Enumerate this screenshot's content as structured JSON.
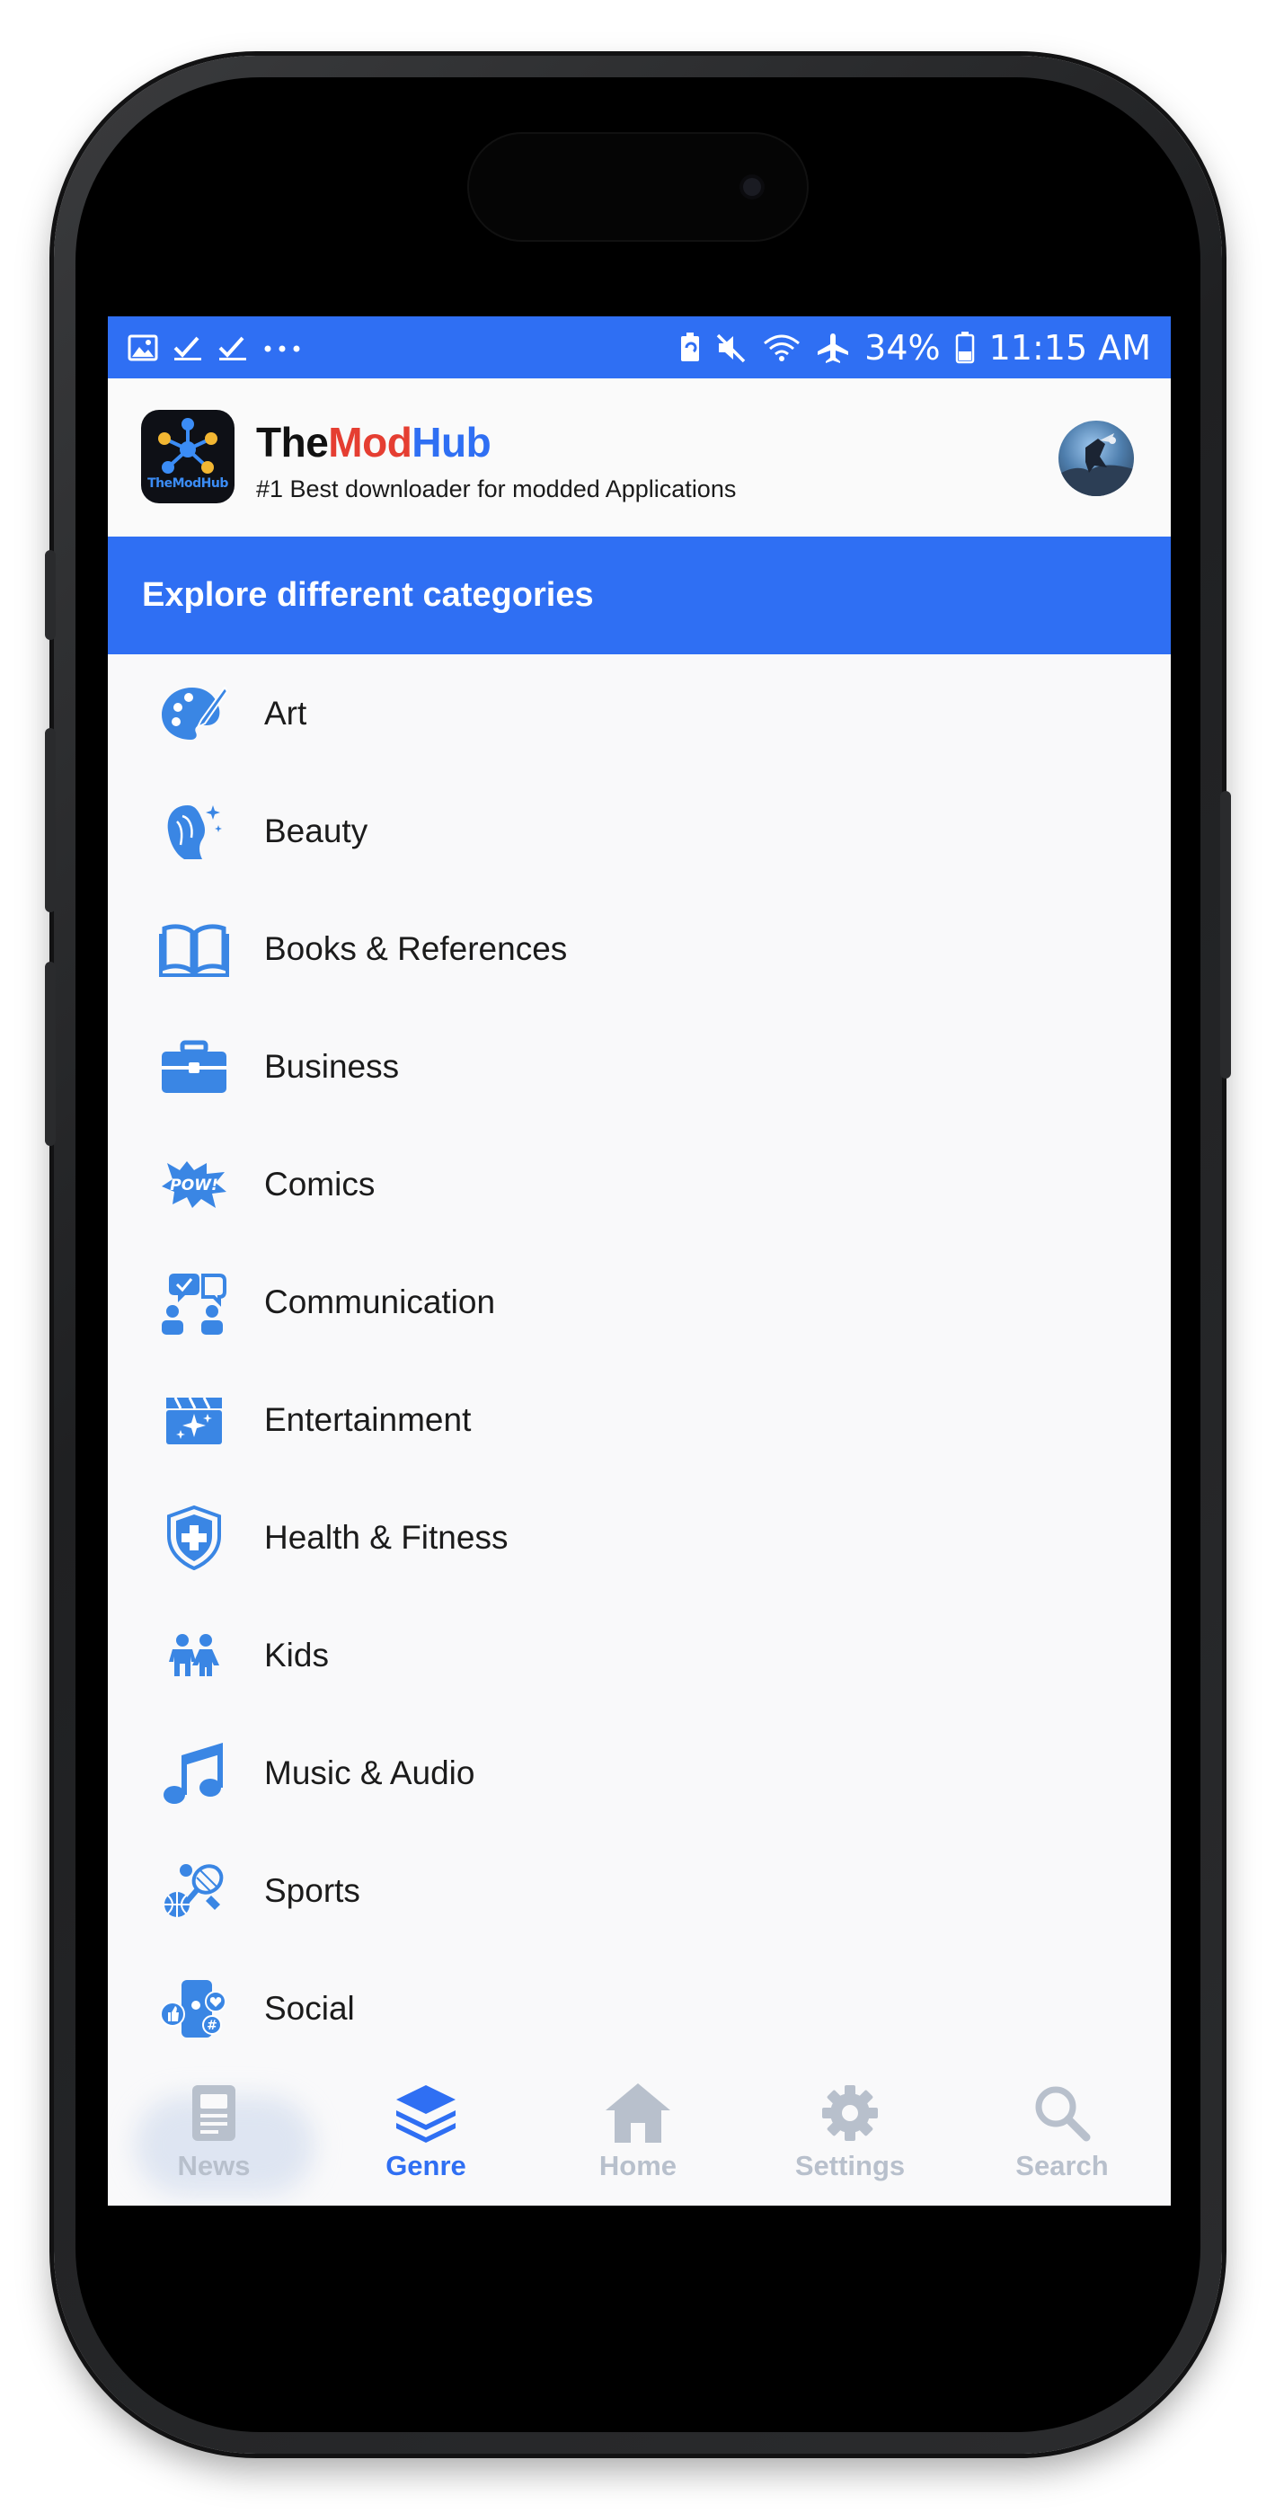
{
  "statusbar": {
    "battery": "34%",
    "time": "11:15 AM",
    "left_icons": [
      "image-icon",
      "check-icon",
      "check-icon",
      "more-icon"
    ],
    "right_icons": [
      "battery-saver-icon",
      "mute-icon",
      "wifi-icon",
      "airplane-icon",
      "battery-icon"
    ]
  },
  "app": {
    "brand_part1": "The",
    "brand_part2": "Mod",
    "brand_part3": "Hub",
    "logo_text": "TheModHub",
    "tagline": "#1 Best downloader for modded Applications"
  },
  "banner": {
    "title": "Explore different categories"
  },
  "categories": [
    {
      "label": "Art",
      "icon": "palette-icon"
    },
    {
      "label": "Beauty",
      "icon": "beauty-face-icon"
    },
    {
      "label": "Books & References",
      "icon": "open-book-icon"
    },
    {
      "label": "Business",
      "icon": "briefcase-icon"
    },
    {
      "label": "Comics",
      "icon": "pow-burst-icon"
    },
    {
      "label": "Communication",
      "icon": "chat-people-icon"
    },
    {
      "label": "Entertainment",
      "icon": "clapperboard-icon"
    },
    {
      "label": "Health & Fitness",
      "icon": "medical-shield-icon"
    },
    {
      "label": "Kids",
      "icon": "kids-icon"
    },
    {
      "label": "Music & Audio",
      "icon": "music-note-icon"
    },
    {
      "label": "Sports",
      "icon": "sports-balls-icon"
    },
    {
      "label": "Social",
      "icon": "social-phone-icon"
    }
  ],
  "nav": {
    "items": [
      {
        "label": "News",
        "icon": "newspaper-icon",
        "active": false
      },
      {
        "label": "Genre",
        "icon": "layers-icon",
        "active": true
      },
      {
        "label": "Home",
        "icon": "home-icon",
        "active": false
      },
      {
        "label": "Settings",
        "icon": "gear-icon",
        "active": false
      },
      {
        "label": "Search",
        "icon": "search-icon",
        "active": false
      }
    ]
  },
  "colors": {
    "accent": "#2f6ff3",
    "icon_blue": "#3a86e4",
    "nav_inactive": "#b8c0cc",
    "brand_red": "#e53e32"
  }
}
